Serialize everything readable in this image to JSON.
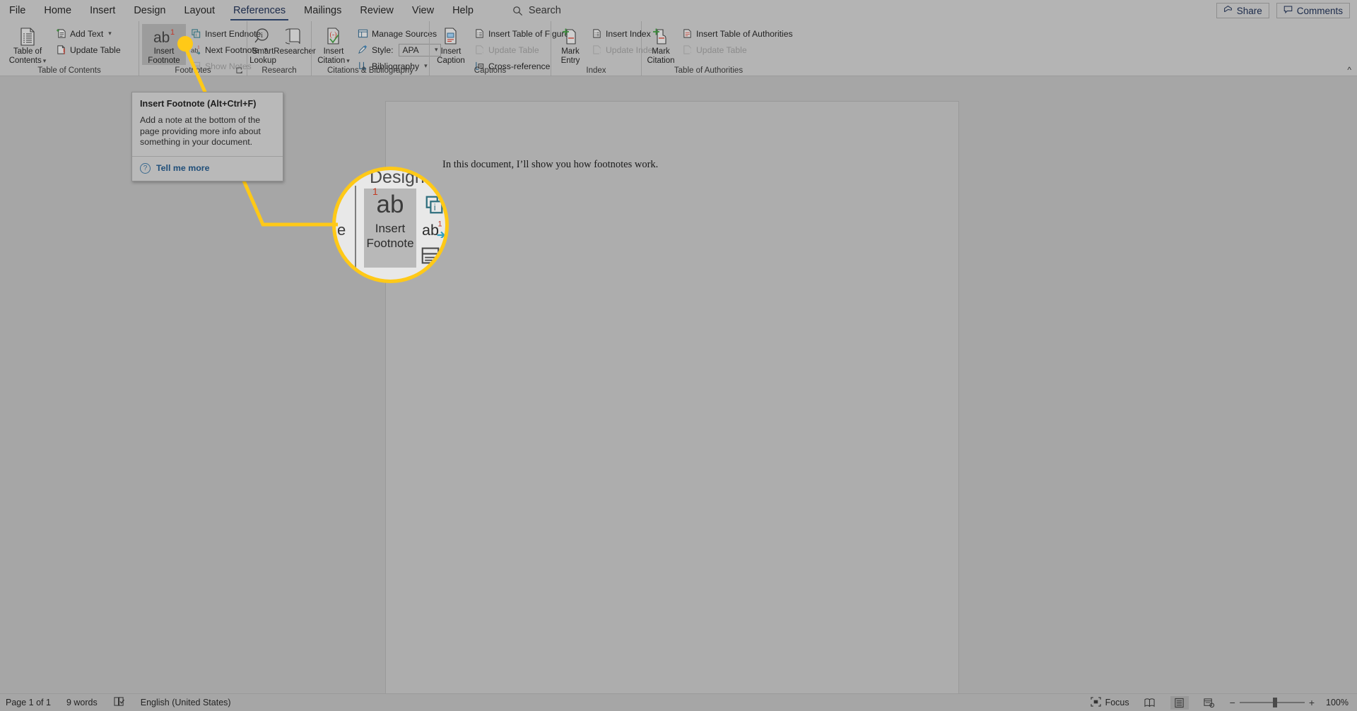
{
  "window": {
    "tabs": [
      {
        "label": "File",
        "active": false
      },
      {
        "label": "Home",
        "active": false
      },
      {
        "label": "Insert",
        "active": false
      },
      {
        "label": "Design",
        "active": false
      },
      {
        "label": "Layout",
        "active": false
      },
      {
        "label": "References",
        "active": true
      },
      {
        "label": "Mailings",
        "active": false
      },
      {
        "label": "Review",
        "active": false
      },
      {
        "label": "View",
        "active": false
      },
      {
        "label": "Help",
        "active": false
      }
    ],
    "search": {
      "label": "Search",
      "icon": "search-icon"
    },
    "share_label": "Share",
    "comments_label": "Comments",
    "collapse_ribbon": "^"
  },
  "ribbon": {
    "groups": [
      {
        "name": "table-of-contents",
        "label": "Table of Contents",
        "big": [
          {
            "line1": "Table of",
            "line2": "Contents",
            "caret": true,
            "icon": "toc-icon"
          }
        ],
        "small": [
          {
            "label": "Add Text",
            "caret": true,
            "disabled": false,
            "icon": "add-text-icon"
          },
          {
            "label": "Update Table",
            "caret": false,
            "disabled": false,
            "icon": "update-table-icon"
          }
        ]
      },
      {
        "name": "footnotes",
        "label": "Footnotes",
        "launcher": true,
        "big": [
          {
            "line1": "Insert",
            "line2": "Footnote",
            "caret": false,
            "selected": true,
            "icon": "insert-footnote-icon"
          }
        ],
        "small": [
          {
            "label": "Insert Endnote",
            "caret": false,
            "disabled": false,
            "icon": "insert-endnote-icon"
          },
          {
            "label": "Next Footnote",
            "caret": true,
            "disabled": false,
            "icon": "next-footnote-icon"
          },
          {
            "label": "Show Notes",
            "caret": false,
            "disabled": true,
            "icon": "show-notes-icon"
          }
        ]
      },
      {
        "name": "research",
        "label": "Research",
        "big": [
          {
            "line1": "Smart",
            "line2": "Lookup",
            "caret": false,
            "icon": "smart-lookup-icon"
          },
          {
            "line1": "Researcher",
            "line2": "",
            "caret": false,
            "icon": "researcher-icon"
          }
        ],
        "small": []
      },
      {
        "name": "citations-bibliography",
        "label": "Citations & Bibliography",
        "big": [
          {
            "line1": "Insert",
            "line2": "Citation",
            "caret": true,
            "icon": "insert-citation-icon"
          }
        ],
        "small": [
          {
            "label": "Manage Sources",
            "caret": false,
            "disabled": false,
            "icon": "manage-sources-icon"
          },
          {
            "label": "Style:",
            "caret": false,
            "disabled": false,
            "icon": "style-icon",
            "select": "APA"
          },
          {
            "label": "Bibliography",
            "caret": true,
            "disabled": false,
            "icon": "bibliography-icon"
          }
        ]
      },
      {
        "name": "captions",
        "label": "Captions",
        "big": [
          {
            "line1": "Insert",
            "line2": "Caption",
            "caret": false,
            "icon": "insert-caption-icon"
          }
        ],
        "small": [
          {
            "label": "Insert Table of Figures",
            "caret": false,
            "disabled": false,
            "icon": "insert-table-of-figures-icon"
          },
          {
            "label": "Update Table",
            "caret": false,
            "disabled": true,
            "icon": "update-table-icon"
          },
          {
            "label": "Cross-reference",
            "caret": false,
            "disabled": false,
            "icon": "cross-reference-icon"
          }
        ]
      },
      {
        "name": "index",
        "label": "Index",
        "big": [
          {
            "line1": "Mark",
            "line2": "Entry",
            "caret": false,
            "icon": "mark-entry-icon"
          }
        ],
        "small": [
          {
            "label": "Insert Index",
            "caret": false,
            "disabled": false,
            "icon": "insert-index-icon"
          },
          {
            "label": "Update Index",
            "caret": false,
            "disabled": true,
            "icon": "update-index-icon"
          }
        ]
      },
      {
        "name": "table-of-authorities",
        "label": "Table of Authorities",
        "big": [
          {
            "line1": "Mark",
            "line2": "Citation",
            "caret": false,
            "icon": "mark-citation-icon"
          }
        ],
        "small": [
          {
            "label": "Insert Table of Authorities",
            "caret": false,
            "disabled": false,
            "icon": "insert-table-of-authorities-icon"
          },
          {
            "label": "Update Table",
            "caret": false,
            "disabled": true,
            "icon": "update-table-icon"
          }
        ]
      }
    ]
  },
  "tooltip": {
    "title": "Insert Footnote (Alt+Ctrl+F)",
    "body": "Add a note at the bottom of the page providing more info about something in your document.",
    "link": "Tell me more",
    "link_icon": "help-circle-icon"
  },
  "magnifier": {
    "partial_tab": "Design",
    "partial_left": "e",
    "button": {
      "glyph": "ab",
      "superscript": "1",
      "line1": "Insert",
      "line2": "Footnote"
    },
    "accent_color": "#ffc917"
  },
  "document": {
    "body_text": "In this document, I’ll show you how footnotes work."
  },
  "status": {
    "page": "Page 1 of 1",
    "words": "9 words",
    "proofing_icon": "proofing-icon",
    "language": "English (United States)",
    "focus_label": "Focus",
    "views": [
      {
        "name": "read-mode-view",
        "icon": "read-mode-icon",
        "active": false
      },
      {
        "name": "print-layout-view",
        "icon": "print-layout-icon",
        "active": true
      },
      {
        "name": "web-layout-view",
        "icon": "web-layout-icon",
        "active": false
      }
    ],
    "zoom_out": "−",
    "zoom_in": "+",
    "zoom_level": "100%"
  }
}
